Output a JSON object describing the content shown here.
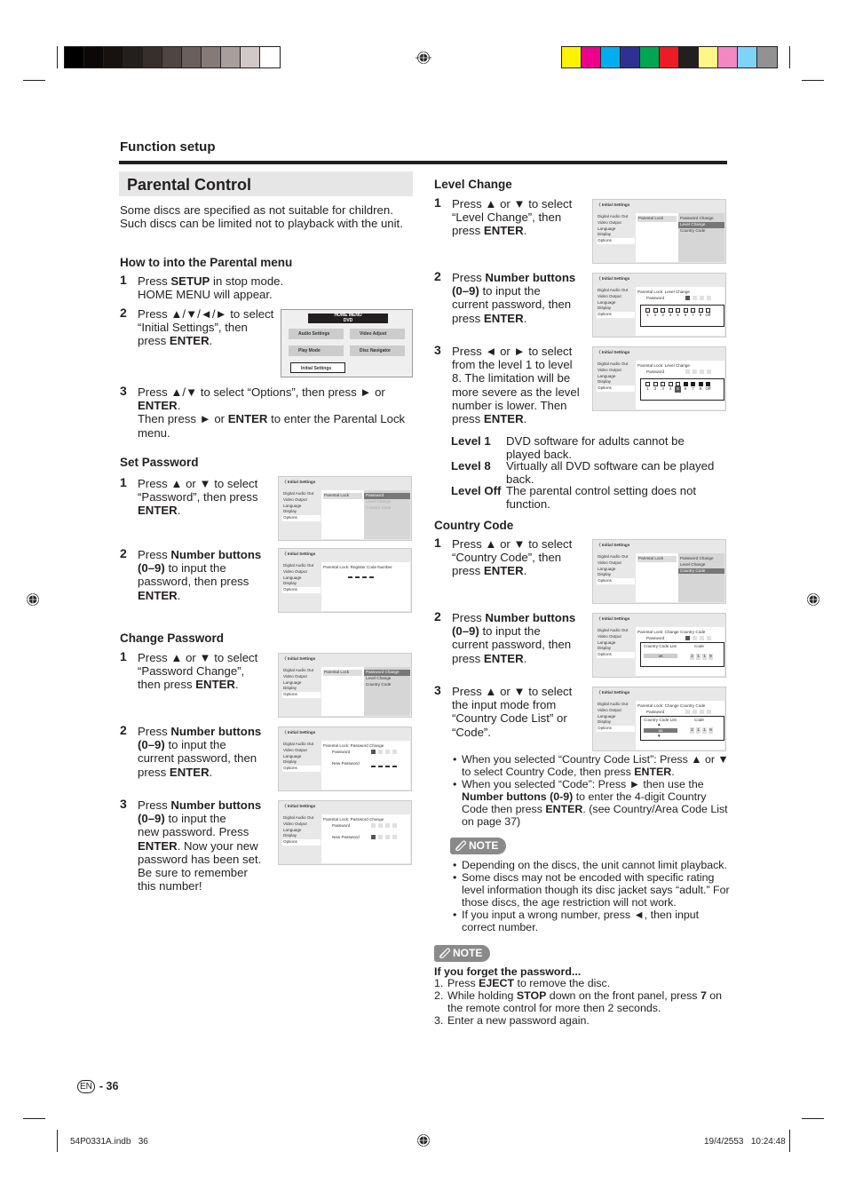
{
  "registration": {
    "gray_swatches": [
      "#000000",
      "#0b0807",
      "#171210",
      "#231f1d",
      "#382f2c",
      "#4f4542",
      "#6a5f5b",
      "#857a76",
      "#a89e9b",
      "#d1c9c7",
      "#ffffff"
    ],
    "color_swatches": [
      "#fff200",
      "#ec008c",
      "#00aeef",
      "#2e3192",
      "#00a651",
      "#ed1c24",
      "#231f20",
      "#fff685",
      "#f287c4",
      "#7fd3f7",
      "#929292"
    ]
  },
  "header": {
    "section": "Function setup",
    "title": "Parental Control"
  },
  "intro": "Some discs are specified as not suitable for children. Such discs can be limited not to playback with the unit.",
  "how_to": {
    "heading": "How to into the Parental menu",
    "steps": [
      {
        "n": "1",
        "html": "Press <b>SETUP</b> in stop mode.<br>HOME MENU will appear."
      },
      {
        "n": "2",
        "html": "Press ▲/▼/◄/► to select<br>“Initial Settings”, then<br>press <b>ENTER</b>."
      },
      {
        "n": "3",
        "html": "Press ▲/▼ to select “Options”, then press ► or<br><b>ENTER</b>.<br>Then press ► or <b>ENTER</b> to enter the Parental Lock<br>menu."
      }
    ],
    "home_menu": {
      "title": "HOME MENU",
      "subtitle": "DVD",
      "items": [
        "Audio Settings",
        "Video Adjust",
        "Play Mode",
        "Disc Navigator",
        "Initial Settings"
      ]
    }
  },
  "screen_common": {
    "header": "Initial Settings",
    "menu": [
      "Digital Audio Out",
      "Video Output",
      "Language",
      "Display",
      "Options"
    ],
    "parental_lock": "Parental Lock",
    "submenu": [
      "Password",
      "Level Change",
      "Country Code"
    ],
    "submenu2": [
      "Password Change",
      "Level Change",
      "Country Code"
    ],
    "password_label": "Password",
    "new_password_label": "New Password",
    "register_title": "Parental Lock: Register Code Number",
    "pw_change_title": "Parental Lock: Password Change",
    "level_title": "Parental Lock: Level Change",
    "country_title": "Parental Lock: Change Country Code",
    "levels": [
      "1",
      "2",
      "3",
      "4",
      "5",
      "6",
      "7",
      "8",
      "Off"
    ],
    "country_list_label": "Country Code List",
    "code_label": "Code",
    "country_value": "us",
    "code_digits": [
      "2",
      "1",
      "1",
      "9"
    ]
  },
  "set_password": {
    "heading": "Set Password",
    "steps": [
      {
        "n": "1",
        "html": "Press ▲ or ▼ to select<br>“Password”, then press<br><b>ENTER</b>."
      },
      {
        "n": "2",
        "html": "Press <b>Number buttons<br>(0–9)</b> to input the<br>password, then press<br><b>ENTER</b>."
      }
    ]
  },
  "change_password": {
    "heading": "Change Password",
    "steps": [
      {
        "n": "1",
        "html": "Press ▲ or ▼ to select<br>“Password Change”,<br>then press <b>ENTER</b>."
      },
      {
        "n": "2",
        "html": "Press <b>Number buttons<br>(0–9)</b> to input the<br>current password, then<br>press <b>ENTER</b>."
      },
      {
        "n": "3",
        "html": "Press <b>Number buttons<br>(0–9)</b> to input the<br>new password. Press<br><b>ENTER</b>. Now your new<br>password has been set.<br>Be sure to remember<br>this number!"
      }
    ]
  },
  "level_change": {
    "heading": "Level Change",
    "steps": [
      {
        "n": "1",
        "html": "Press ▲ or ▼ to select<br>“Level Change”, then<br>press <b>ENTER</b>."
      },
      {
        "n": "2",
        "html": "Press <b>Number buttons<br>(0–9)</b> to input the<br>current password, then<br>press <b>ENTER</b>."
      },
      {
        "n": "3",
        "html": "Press ◄ or ► to select<br>from the level 1 to level<br>8. The limitation will be<br>more severe as the level<br>number is lower. Then<br>press <b>ENTER</b>."
      }
    ],
    "level_notes": [
      {
        "key": "Level 1",
        "text": "DVD software for adults cannot be played back."
      },
      {
        "key": "Level 8",
        "text": "Virtually all DVD software can be played back."
      },
      {
        "key": "Level Off",
        "text": "The parental control setting does not function."
      }
    ]
  },
  "country_code": {
    "heading": "Country Code",
    "steps": [
      {
        "n": "1",
        "html": "Press ▲ or ▼ to select<br>“Country Code”, then<br>press <b>ENTER</b>."
      },
      {
        "n": "2",
        "html": "Press <b>Number buttons<br>(0–9)</b> to input the<br>current password, then<br>press <b>ENTER</b>."
      },
      {
        "n": "3",
        "html": "Press ▲ or ▼ to select<br>the input mode from<br>“Country Code List” or<br>“Code”."
      }
    ],
    "bullets": [
      "When you selected “Country Code List”: Press ▲ or ▼ to select Country Code, then press <b>ENTER</b>.",
      "When you selected “Code”: Press ► then use the <b>Number buttons (0-9)</b> to enter the 4-digit Country Code then press <b>ENTER</b>. (see Country/Area Code List on page 37)"
    ]
  },
  "note1": {
    "label": "NOTE",
    "bullets": [
      "Depending on the discs, the unit cannot limit playback.",
      "Some discs may not be encoded with specific rating level information though its disc jacket says “adult.” For those discs, the age restriction will not work.",
      "If you input a wrong number, press ◄, then input correct number."
    ]
  },
  "note2": {
    "label": "NOTE",
    "heading": "If you forget the password...",
    "items": [
      "Press <b>EJECT</b> to remove the disc.",
      "While holding <b>STOP</b> down on the front panel, press <b>7</b> on the remote control for more then 2 seconds.",
      "Enter a new password again."
    ]
  },
  "footer": {
    "lang": "EN",
    "page": "- 36",
    "file": "54P0331A.indb   36",
    "timestamp": "19/4/2553   10:24:48"
  }
}
